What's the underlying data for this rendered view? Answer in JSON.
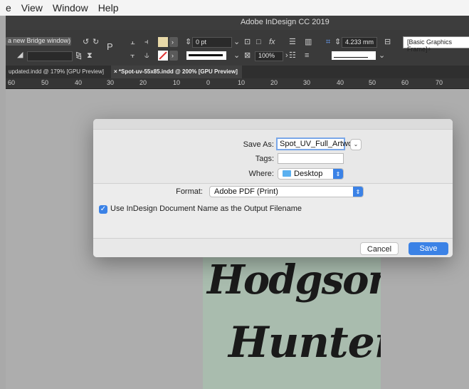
{
  "menubar": {
    "items": [
      "e",
      "View",
      "Window",
      "Help"
    ]
  },
  "app": {
    "title": "Adobe InDesign CC 2019"
  },
  "control_panel": {
    "bridge_label": "a new Bridge window)",
    "stroke_weight": "0 pt",
    "zoom": "100%",
    "dimension": "4.233 mm",
    "frame_style": "[Basic Graphics Frame]+"
  },
  "tabs": [
    {
      "label": "updated.indd @ 179% [GPU Preview]"
    },
    {
      "label": "*Spot-uv-55x85.indd @ 200% [GPU Preview]"
    }
  ],
  "ruler": {
    "labels": [
      "60",
      "50",
      "40",
      "30",
      "20",
      "10",
      "0",
      "10",
      "20",
      "30",
      "40",
      "50",
      "60",
      "70"
    ]
  },
  "artwork": {
    "line1": "Hodgson",
    "line2": "Hunter"
  },
  "dialog": {
    "save_as_label": "Save As:",
    "save_as_value": "Spot_UV_Full_Artwork",
    "tags_label": "Tags:",
    "tags_value": "",
    "where_label": "Where:",
    "where_value": "Desktop",
    "format_label": "Format:",
    "format_value": "Adobe PDF (Print)",
    "checkbox_label": "Use InDesign Document Name as the Output Filename",
    "checkbox_checked": true,
    "cancel_label": "Cancel",
    "save_label": "Save"
  },
  "colors": {
    "accent": "#3b82e6",
    "artboard": "#a9bcae",
    "folder": "#5ab0f0"
  }
}
